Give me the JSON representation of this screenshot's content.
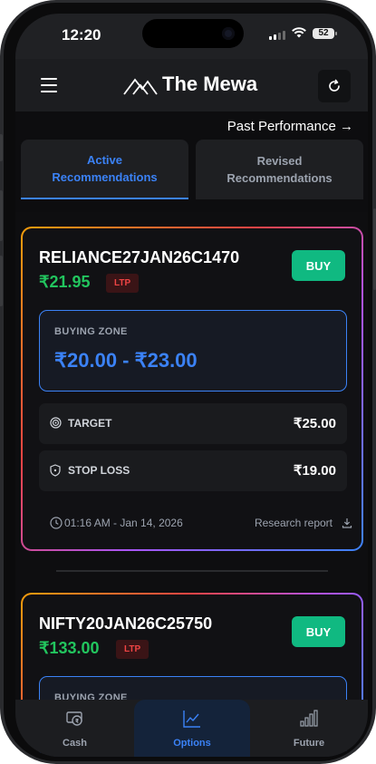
{
  "status_bar": {
    "time": "12:20",
    "battery": "52"
  },
  "app_bar": {
    "title": "The Mewa"
  },
  "past_performance": "Past Performance →",
  "tabs": [
    {
      "label_line1": "Active",
      "label_line2": "Recommendations"
    },
    {
      "label_line1": "Revised",
      "label_line2": "Recommendations"
    }
  ],
  "cards": [
    {
      "symbol": "RELIANCE27JAN26C1470",
      "price": "₹21.95",
      "ltp_label": "LTP",
      "action": "BUY",
      "buying_zone_label": "BUYING ZONE",
      "buying_zone_value": "₹20.00 - ₹23.00",
      "target_label": "TARGET",
      "target_value": "₹25.00",
      "stop_loss_label": "STOP LOSS",
      "stop_loss_value": "₹19.00",
      "timestamp": "01:16 AM - Jan 14, 2026",
      "report_label": "Research report"
    },
    {
      "symbol": "NIFTY20JAN26C25750",
      "price": "₹133.00",
      "ltp_label": "LTP",
      "action": "BUY",
      "buying_zone_label": "BUYING ZONE"
    }
  ],
  "bottom_nav": [
    {
      "label": "Cash",
      "icon": "cash-icon"
    },
    {
      "label": "Options",
      "icon": "chart-line-icon",
      "active": true
    },
    {
      "label": "Future",
      "icon": "bar-chart-icon"
    }
  ],
  "colors": {
    "accent": "#3b82f6",
    "buy": "#10b981",
    "price": "#22c55e",
    "ltp": "#ef4444"
  }
}
